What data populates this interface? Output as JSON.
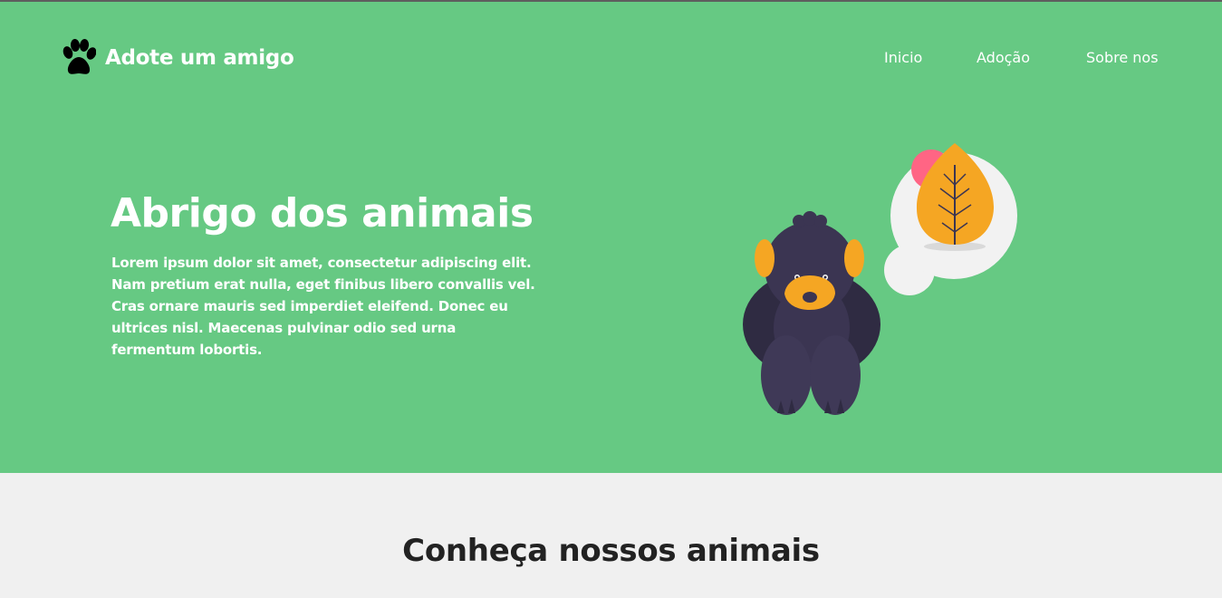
{
  "header": {
    "logo_icon": "paw-icon",
    "logo_text": "Adote um amigo",
    "nav": [
      {
        "label": "Inicio"
      },
      {
        "label": "Adoção"
      },
      {
        "label": "Sobre nos"
      }
    ]
  },
  "hero": {
    "title": "Abrigo dos animais",
    "text": "Lorem ipsum dolor sit amet, consectetur adipiscing elit. Nam pretium erat nulla, eget finibus libero convallis vel. Cras ornare mauris sed imperdiet eleifend. Donec eu ultrices nisl. Maecenas pulvinar odio sed urna fermentum lobortis.",
    "illustration": "dog-dreaming-of-leaf-illustration"
  },
  "section": {
    "title": "Conheça nossos animais"
  },
  "colors": {
    "hero_background": "#66c983",
    "page_background": "#f0f0f0",
    "accent_orange": "#f5a623",
    "dog_dark": "#3b3552",
    "bubble": "#f2f2f2",
    "pink": "#ff6584"
  }
}
